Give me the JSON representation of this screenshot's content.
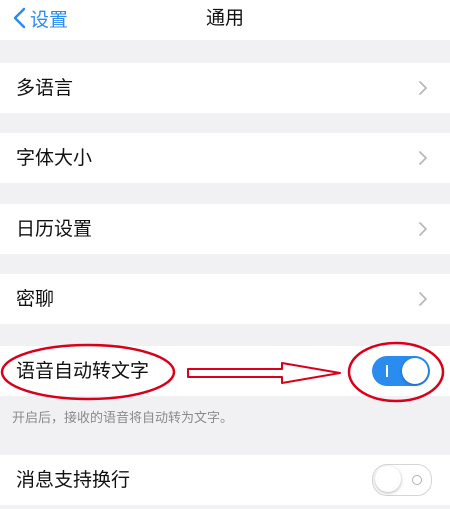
{
  "nav": {
    "back_label": "设置",
    "title": "通用"
  },
  "rows": {
    "multilang": "多语言",
    "fontsize": "字体大小",
    "calendar": "日历设置",
    "secret_chat": "密聊",
    "voice_to_text": "语音自动转文字",
    "multiline": "消息支持换行"
  },
  "voice_to_text": {
    "enabled": true,
    "hint": "开启后，接收的语音将自动转为文字。"
  },
  "multiline": {
    "enabled": false
  },
  "colors": {
    "accent": "#2b8cf0",
    "annotation": "#d9001b",
    "background": "#f1f1f3"
  },
  "icons": {
    "back": "chevron-left-icon",
    "row_chevron": "chevron-right-icon"
  }
}
